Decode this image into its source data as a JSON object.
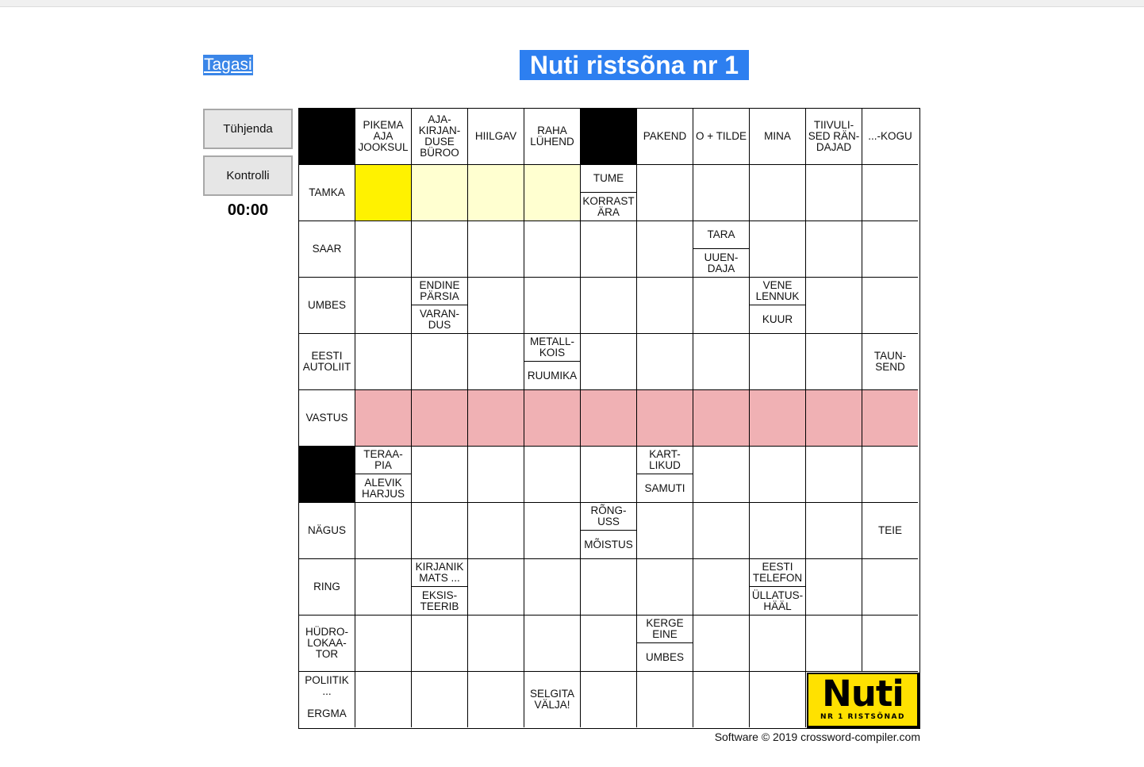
{
  "nav": {
    "back_label": "Tagasi"
  },
  "title": "Nuti ristsõna nr 1",
  "buttons": {
    "clear_label": "Tühjenda",
    "check_label": "Kontrolli"
  },
  "timer": "00:00",
  "grid": {
    "rows": 11,
    "cols": 11,
    "cells": [
      [
        {
          "t": "black"
        },
        {
          "t": "clue",
          "text": "PIKEMA\nAJA\nJOOKSUL"
        },
        {
          "t": "clue",
          "text": "AJA-\nKIRJAN-\nDUSE\nBÜROO"
        },
        {
          "t": "clue",
          "text": "HIILGAV"
        },
        {
          "t": "clue",
          "text": "RAHA\nLÜHEND"
        },
        {
          "t": "black"
        },
        {
          "t": "clue",
          "text": "PAKEND"
        },
        {
          "t": "clue",
          "text": "O + TILDE"
        },
        {
          "t": "clue",
          "text": "MINA"
        },
        {
          "t": "clue",
          "text": "TIIVULI-\nSED RÄN-\nDAJAD"
        },
        {
          "t": "clue",
          "text": "...-KOGU"
        }
      ],
      [
        {
          "t": "clue",
          "text": "TAMKA"
        },
        {
          "t": "cur"
        },
        {
          "t": "hl"
        },
        {
          "t": "hl"
        },
        {
          "t": "hl"
        },
        {
          "t": "clue2",
          "top": "TUME",
          "bottom": "KORRAST\nÄRA"
        },
        {
          "t": "input"
        },
        {
          "t": "input"
        },
        {
          "t": "input"
        },
        {
          "t": "input"
        },
        {
          "t": "input"
        }
      ],
      [
        {
          "t": "clue",
          "text": "SAAR"
        },
        {
          "t": "input"
        },
        {
          "t": "input"
        },
        {
          "t": "input"
        },
        {
          "t": "input"
        },
        {
          "t": "input"
        },
        {
          "t": "input"
        },
        {
          "t": "clue2",
          "top": "TARA",
          "bottom": "UUEN-\nDAJA"
        },
        {
          "t": "input"
        },
        {
          "t": "input"
        },
        {
          "t": "input"
        }
      ],
      [
        {
          "t": "clue",
          "text": "UMBES"
        },
        {
          "t": "input"
        },
        {
          "t": "clue2",
          "top": "ENDINE\nPÄRSIA",
          "bottom": "VARAN-\nDUS"
        },
        {
          "t": "input"
        },
        {
          "t": "input"
        },
        {
          "t": "input"
        },
        {
          "t": "input"
        },
        {
          "t": "input"
        },
        {
          "t": "clue2",
          "top": "VENE\nLENNUK",
          "bottom": "KUUR"
        },
        {
          "t": "input"
        },
        {
          "t": "input"
        }
      ],
      [
        {
          "t": "clue",
          "text": "EESTI\nAUTOLIIT"
        },
        {
          "t": "input"
        },
        {
          "t": "input"
        },
        {
          "t": "input"
        },
        {
          "t": "clue2",
          "top": "METALL-\nKOIS",
          "bottom": "RUUMIKA"
        },
        {
          "t": "input"
        },
        {
          "t": "input"
        },
        {
          "t": "input"
        },
        {
          "t": "input"
        },
        {
          "t": "input"
        },
        {
          "t": "clue",
          "text": "TAUN-\nSEND"
        }
      ],
      [
        {
          "t": "clue",
          "text": "VASTUS"
        },
        {
          "t": "answer"
        },
        {
          "t": "answer"
        },
        {
          "t": "answer"
        },
        {
          "t": "answer"
        },
        {
          "t": "answer"
        },
        {
          "t": "answer"
        },
        {
          "t": "answer"
        },
        {
          "t": "answer"
        },
        {
          "t": "answer"
        },
        {
          "t": "answer"
        }
      ],
      [
        {
          "t": "black"
        },
        {
          "t": "clue2",
          "top": "TERAA-\nPIA",
          "bottom": "ALEVIK\nHARJUS"
        },
        {
          "t": "input"
        },
        {
          "t": "input"
        },
        {
          "t": "input"
        },
        {
          "t": "input"
        },
        {
          "t": "clue2",
          "top": "KART-\nLIKUD",
          "bottom": "SAMUTI"
        },
        {
          "t": "input"
        },
        {
          "t": "input"
        },
        {
          "t": "input"
        },
        {
          "t": "input"
        }
      ],
      [
        {
          "t": "clue",
          "text": "NÄGUS"
        },
        {
          "t": "input"
        },
        {
          "t": "input"
        },
        {
          "t": "input"
        },
        {
          "t": "input"
        },
        {
          "t": "clue2",
          "top": "RÕNG-\nUSS",
          "bottom": "MÕISTUS"
        },
        {
          "t": "input"
        },
        {
          "t": "input"
        },
        {
          "t": "input"
        },
        {
          "t": "input"
        },
        {
          "t": "clue",
          "text": "TEIE"
        }
      ],
      [
        {
          "t": "clue",
          "text": "RING"
        },
        {
          "t": "input"
        },
        {
          "t": "clue2",
          "top": "KIRJANIK\nMATS ...",
          "bottom": "EKSIS-\nTEERIB"
        },
        {
          "t": "input"
        },
        {
          "t": "input"
        },
        {
          "t": "input"
        },
        {
          "t": "input"
        },
        {
          "t": "input"
        },
        {
          "t": "clue2",
          "top": "EESTI\nTELEFON",
          "bottom": "ÜLLATUS-\nHÄÄL"
        },
        {
          "t": "input"
        },
        {
          "t": "input"
        }
      ],
      [
        {
          "t": "clue",
          "text": "HÜDRO-\nLOKAA-\nTOR"
        },
        {
          "t": "input"
        },
        {
          "t": "input"
        },
        {
          "t": "input"
        },
        {
          "t": "input"
        },
        {
          "t": "input"
        },
        {
          "t": "clue2",
          "top": "KERGE\nEINE",
          "bottom": "UMBES"
        },
        {
          "t": "input"
        },
        {
          "t": "input"
        },
        {
          "t": "input"
        },
        {
          "t": "input"
        }
      ],
      [
        {
          "t": "clue2",
          "top": "POLIITIK\n...",
          "bottom": "ERGMA",
          "noline": true
        },
        {
          "t": "input"
        },
        {
          "t": "input"
        },
        {
          "t": "input"
        },
        {
          "t": "clue",
          "text": "SELGITA\nVÄLJA!"
        },
        {
          "t": "input"
        },
        {
          "t": "input"
        },
        {
          "t": "input"
        },
        {
          "t": "input"
        },
        {
          "t": "logo"
        },
        {
          "t": "logo-span"
        }
      ]
    ]
  },
  "logo": {
    "main": "Nuti",
    "sub": "NR 1 RISTSÕNAD"
  },
  "footer": "Software © 2019 crossword-compiler.com"
}
